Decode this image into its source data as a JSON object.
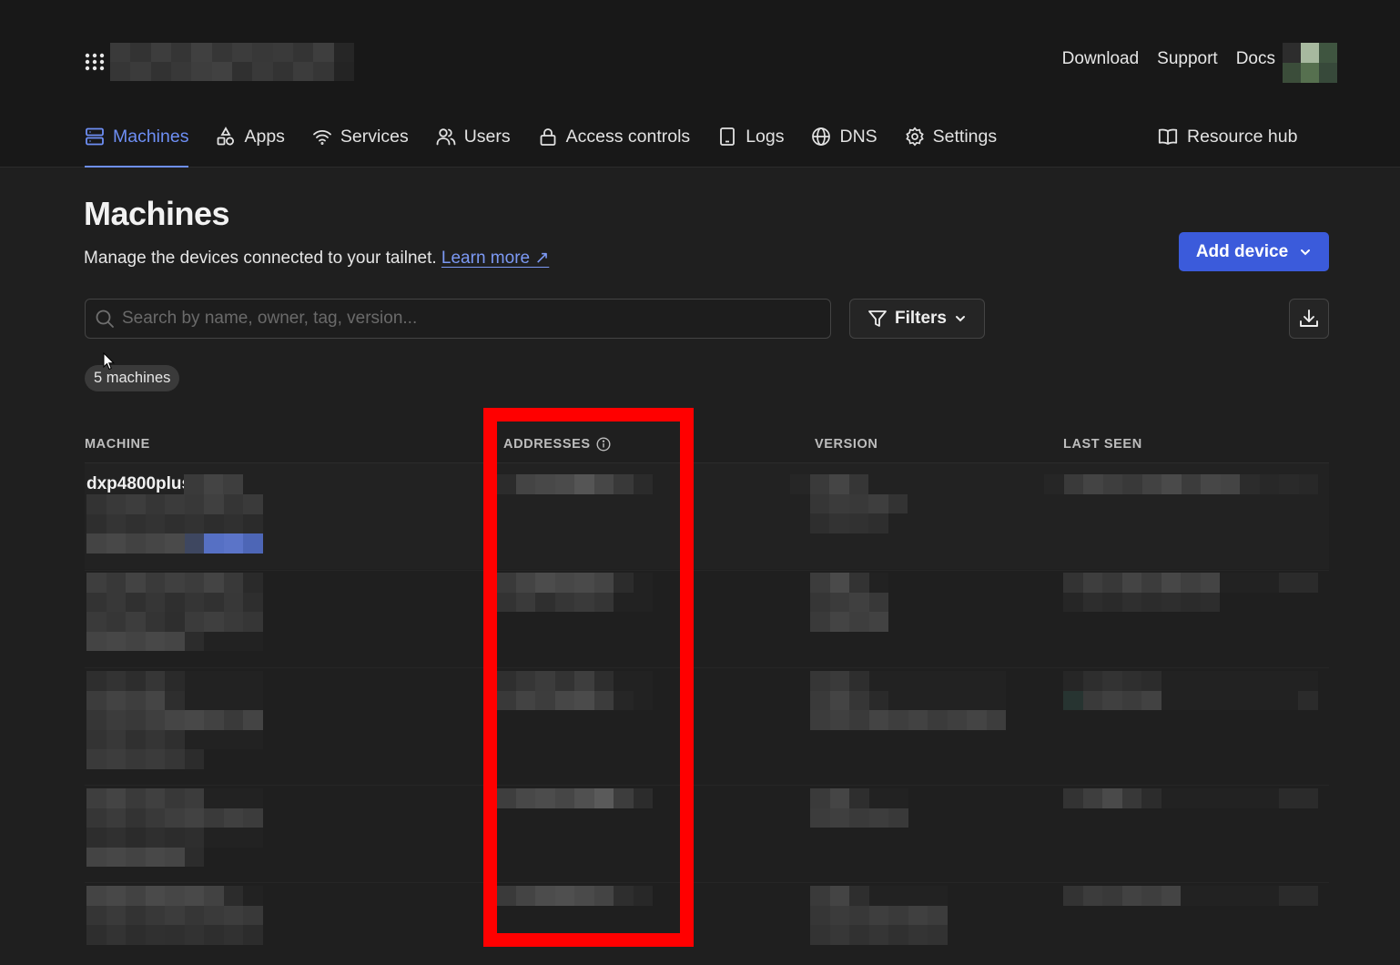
{
  "topbar": {
    "links": [
      "Download",
      "Support",
      "Docs"
    ]
  },
  "nav": {
    "items": [
      {
        "label": "Machines",
        "icon": "server-icon",
        "active": true
      },
      {
        "label": "Apps",
        "icon": "shapes-icon"
      },
      {
        "label": "Services",
        "icon": "wifi-icon"
      },
      {
        "label": "Users",
        "icon": "users-icon"
      },
      {
        "label": "Access controls",
        "icon": "lock-icon"
      },
      {
        "label": "Logs",
        "icon": "tablet-icon"
      },
      {
        "label": "DNS",
        "icon": "globe-icon"
      },
      {
        "label": "Settings",
        "icon": "gear-icon"
      }
    ],
    "resource_hub": "Resource hub"
  },
  "page": {
    "title": "Machines",
    "subtitle": "Manage the devices connected to your tailnet.",
    "learn_more": "Learn more ↗",
    "add_device": "Add device",
    "search_placeholder": "Search by name, owner, tag, version...",
    "filters": "Filters",
    "count": "5 machines"
  },
  "table": {
    "columns": [
      "MACHINE",
      "ADDRESSES",
      "VERSION",
      "LAST SEEN"
    ],
    "rows": [
      {
        "machine": "dxp4800plus"
      }
    ]
  },
  "colors": {
    "accent": "#6e8ff5",
    "button": "#3b5bdb",
    "highlight": "#ff0000"
  }
}
